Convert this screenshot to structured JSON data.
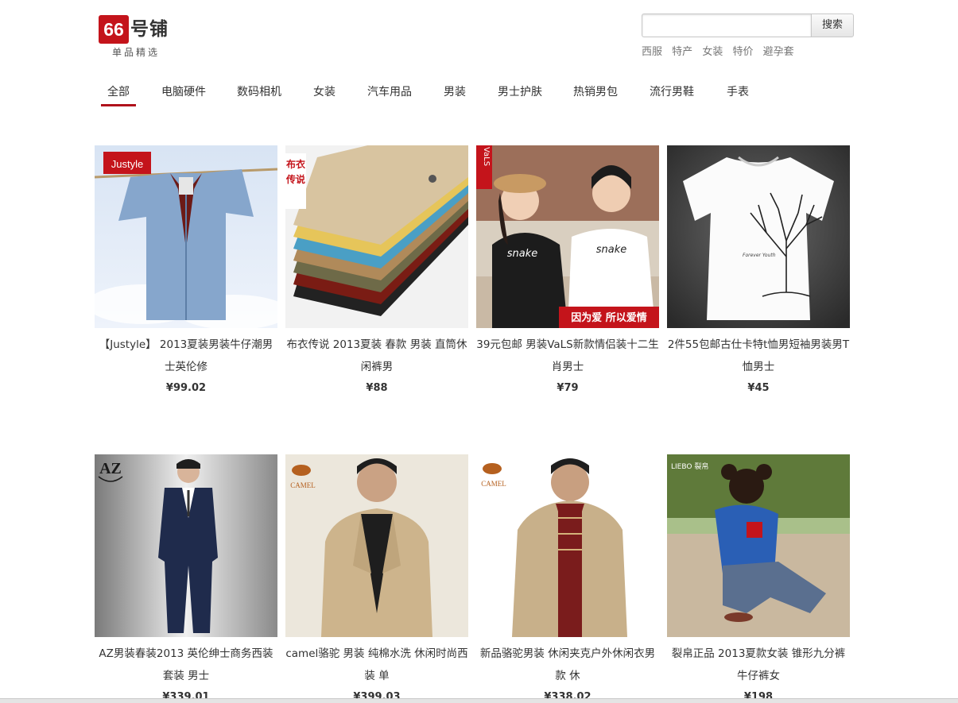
{
  "header": {
    "logo_number": "66",
    "logo_name": "号铺",
    "logo_subtitle": "单品精选",
    "search_placeholder": "",
    "search_button": "搜索",
    "hot_keywords": [
      "西服",
      "特产",
      "女装",
      "特价",
      "避孕套"
    ]
  },
  "nav": {
    "items": [
      "全部",
      "电脑硬件",
      "数码相机",
      "女装",
      "汽车用品",
      "男装",
      "男士护肤",
      "热销男包",
      "流行男鞋",
      "手表"
    ],
    "active_index": 0
  },
  "products": [
    {
      "title": "【Justyle】 2013夏装男装牛仔潮男士英伦修",
      "price": "¥99.02",
      "brand_tag": "Justyle"
    },
    {
      "title": "布衣传说 2013夏装 春款 男装 直筒休闲裤男",
      "price": "¥88",
      "brand_tag": "布衣传说"
    },
    {
      "title": "39元包邮 男装VaLS新款情侣装十二生肖男士",
      "price": "¥79",
      "brand_tag": "VaLS",
      "image_caption": "因为爱 所以爱情",
      "shirt_text": "snake"
    },
    {
      "title": "2件55包邮古仕卡特t恤男短袖男装男T恤男士",
      "price": "¥45"
    },
    {
      "title": "AZ男装春装2013 英伦绅士商务西装套装 男士",
      "price": "¥339.01",
      "brand_tag": "AZ"
    },
    {
      "title": "camel骆驼 男装 纯棉水洗 休闲时尚西装 单",
      "price": "¥399.03",
      "brand_tag": "CAMEL"
    },
    {
      "title": "新品骆驼男装 休闲夹克户外休闲衣男款 休",
      "price": "¥338.02",
      "brand_tag": "CAMEL"
    },
    {
      "title": "裂帛正品 2013夏款女装 锥形九分裤牛仔裤女",
      "price": "¥198",
      "brand_tag": "LIEBO 裂帛"
    }
  ],
  "colors": {
    "accent": "#b0121b",
    "logo_red": "#c4141b"
  }
}
